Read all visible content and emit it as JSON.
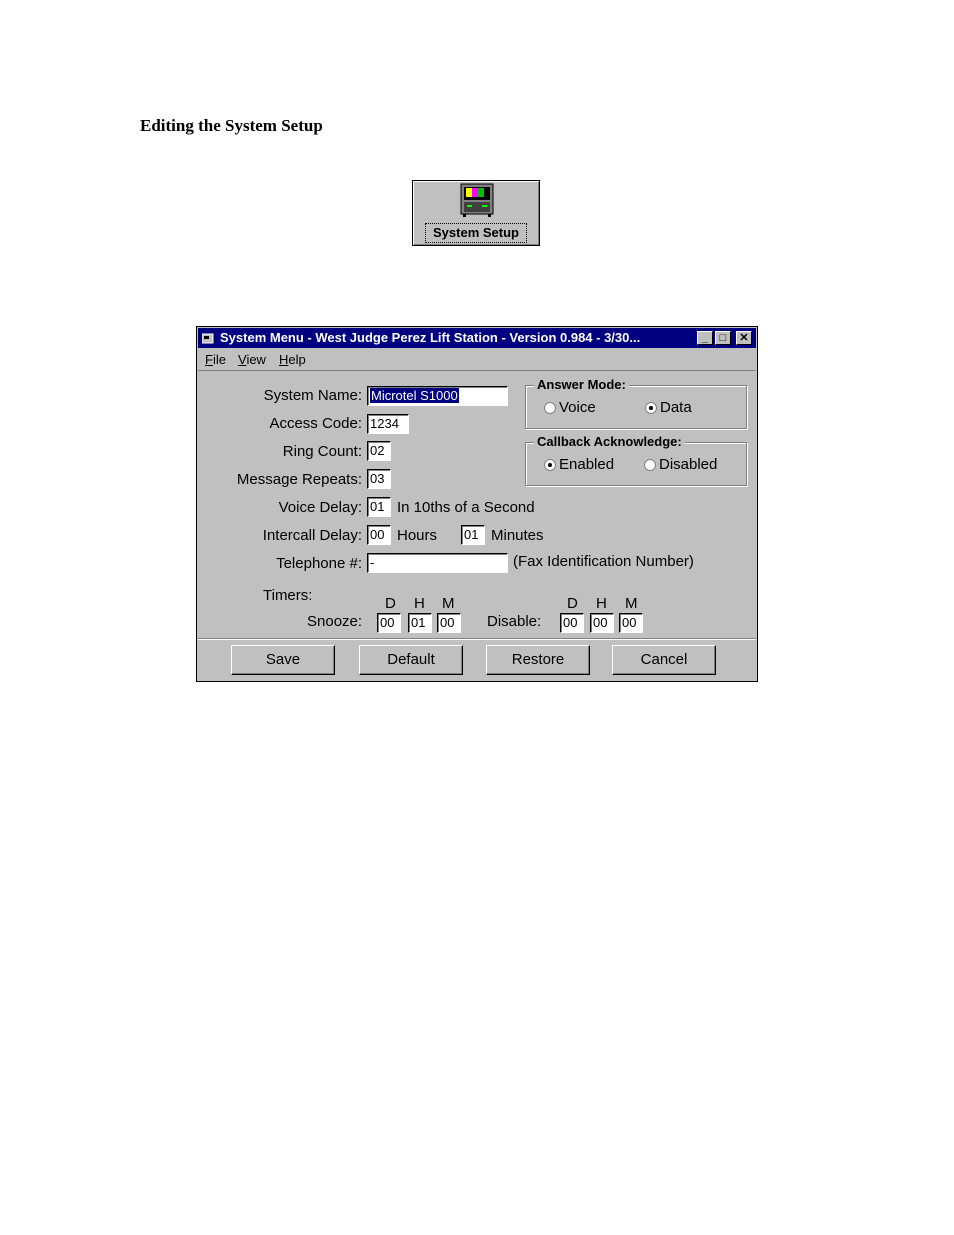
{
  "page": {
    "heading": "Editing the System Setup"
  },
  "setup_button": {
    "label": "System Setup",
    "icon": "computer-icon"
  },
  "window": {
    "title": "System Menu - West Judge Perez Lift Station - Version 0.984 - 3/30...",
    "controls": {
      "minimize": "_",
      "maximize": "□",
      "close": "✕"
    },
    "menu": [
      {
        "label": "File",
        "hotkey": "F",
        "rest": "ile"
      },
      {
        "label": "View",
        "hotkey": "V",
        "rest": "iew"
      },
      {
        "label": "Help",
        "hotkey": "H",
        "rest": "elp"
      }
    ],
    "fields": {
      "system_name": {
        "label": "System Name:",
        "value": "Microtel S1000"
      },
      "access_code": {
        "label": "Access Code:",
        "value": "1234"
      },
      "ring_count": {
        "label": "Ring Count:",
        "value": "02"
      },
      "message_repeats": {
        "label": "Message Repeats:",
        "value": "03"
      },
      "voice_delay": {
        "label": "Voice Delay:",
        "value": "01",
        "suffix": "In 10ths of a Second"
      },
      "intercall_delay": {
        "label": "Intercall Delay:",
        "hours": "00",
        "hours_label": "Hours",
        "minutes": "01",
        "minutes_label": "Minutes"
      },
      "telephone": {
        "label": "Telephone #:",
        "value": "-",
        "suffix": "(Fax Identification Number)"
      }
    },
    "answer_mode": {
      "title": "Answer Mode:",
      "options": [
        "Voice",
        "Data"
      ],
      "selected": "Data"
    },
    "callback": {
      "title": "Callback Acknowledge:",
      "options": [
        "Enabled",
        "Disabled"
      ],
      "selected": "Enabled"
    },
    "timers": {
      "label": "Timers:",
      "col_d": "D",
      "col_h": "H",
      "col_m": "M",
      "snooze": {
        "label": "Snooze:",
        "d": "00",
        "h": "01",
        "m": "00"
      },
      "disable": {
        "label": "Disable:",
        "d": "00",
        "h": "00",
        "m": "00"
      }
    },
    "buttons": {
      "save": "Save",
      "default": "Default",
      "restore": "Restore",
      "cancel": "Cancel"
    }
  }
}
